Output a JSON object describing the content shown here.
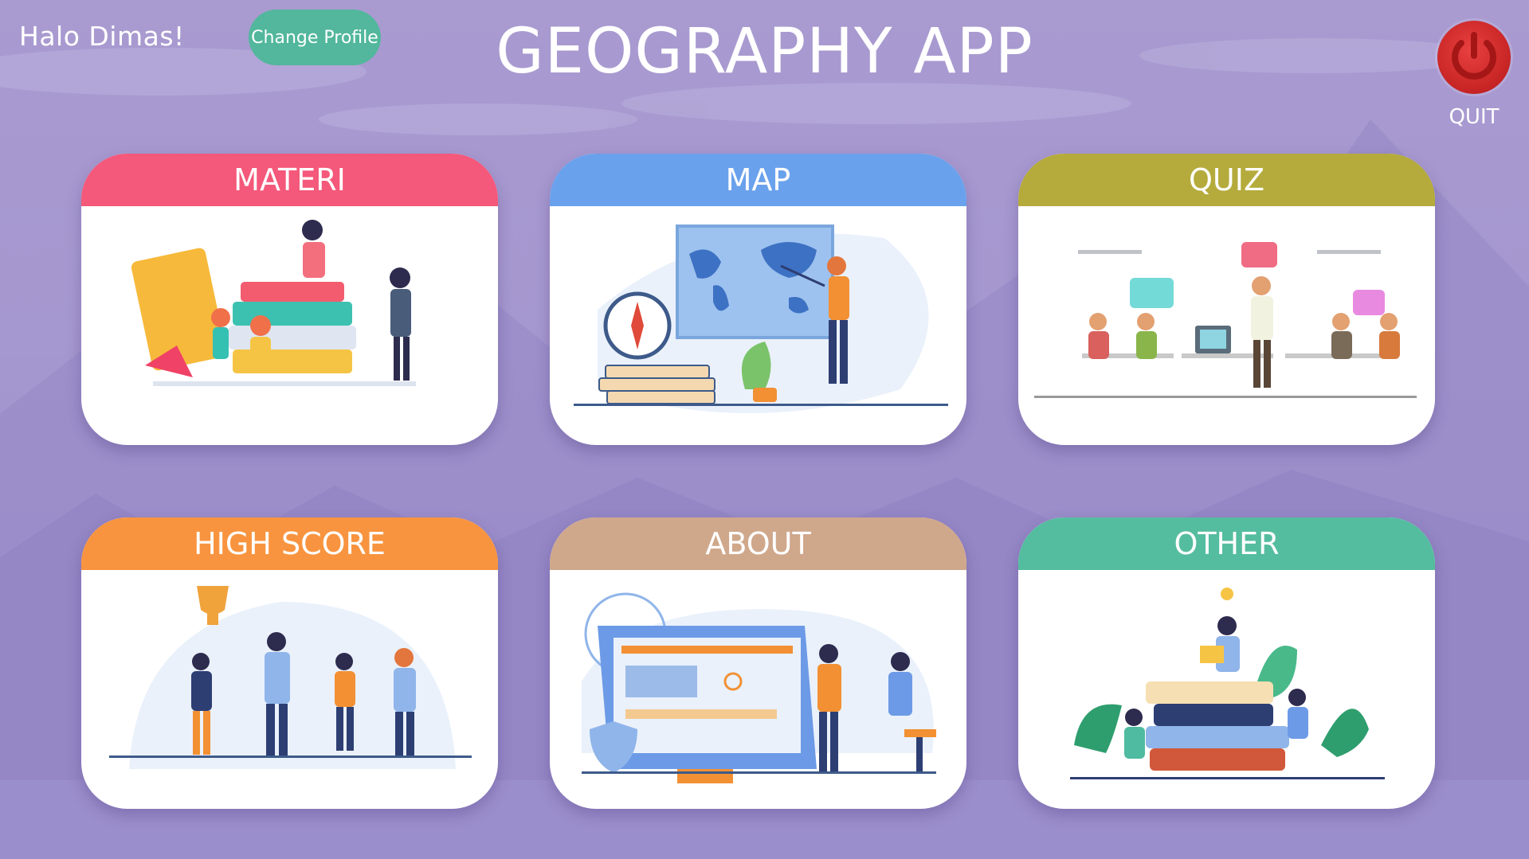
{
  "header": {
    "greeting": "Halo Dimas!",
    "change_profile_label": "Change Profile",
    "app_title": "GEOGRAPHY APP",
    "quit_label": "QUIT"
  },
  "menu": {
    "items": [
      {
        "label": "MATERI",
        "color": "#f4587a"
      },
      {
        "label": "MAP",
        "color": "#6aa1ec"
      },
      {
        "label": "QUIZ",
        "color": "#b5ab3c"
      },
      {
        "label": "HIGH SCORE",
        "color": "#f8943f"
      },
      {
        "label": "ABOUT",
        "color": "#cfa88c"
      },
      {
        "label": "OTHER",
        "color": "#55bd9f"
      }
    ]
  },
  "colors": {
    "background": "#a597cf",
    "change_profile_button": "#52b79c",
    "quit_button": "#d32a2a"
  },
  "icons": [
    "power-icon"
  ]
}
